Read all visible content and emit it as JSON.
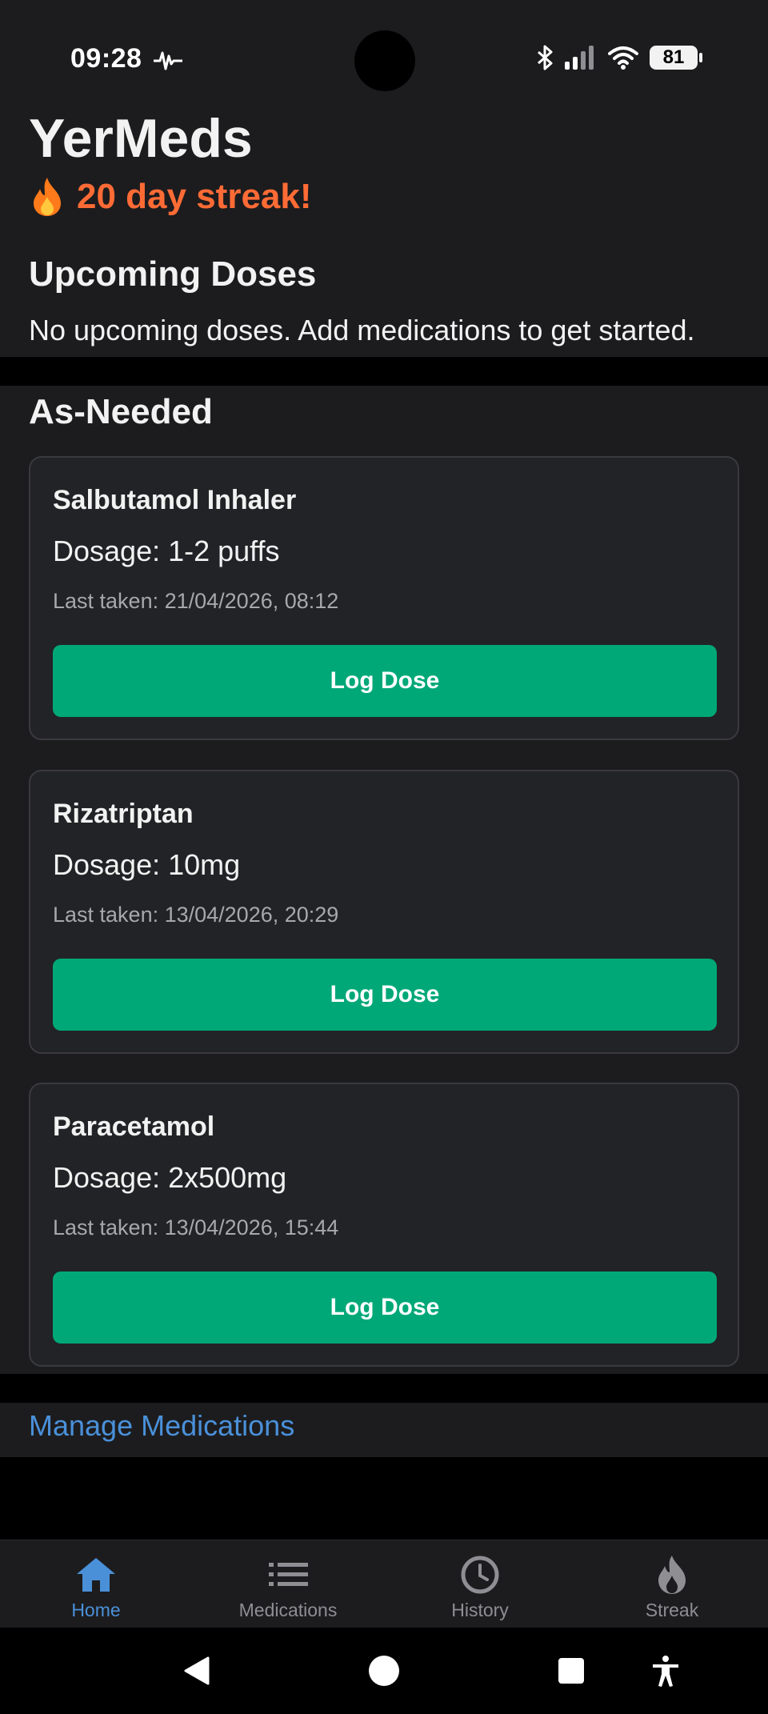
{
  "status_bar": {
    "time": "09:28",
    "battery": "81",
    "icons": [
      "activity-icon",
      "bluetooth-icon",
      "signal-icon",
      "wifi-icon",
      "battery-icon"
    ]
  },
  "header": {
    "app_title": "YerMeds",
    "streak_text": "20 day streak!",
    "streak_color": "#ff6b35"
  },
  "upcoming": {
    "title": "Upcoming Doses",
    "empty_message": "No upcoming doses. Add medications to get started."
  },
  "as_needed": {
    "title": "As-Needed",
    "medications": [
      {
        "name": "Salbutamol Inhaler",
        "dosage": "Dosage: 1-2 puffs",
        "last_taken": "Last taken: 21/04/2026, 08:12",
        "button": "Log Dose"
      },
      {
        "name": "Rizatriptan",
        "dosage": "Dosage: 10mg",
        "last_taken": "Last taken: 13/04/2026, 20:29",
        "button": "Log Dose"
      },
      {
        "name": "Paracetamol",
        "dosage": "Dosage: 2x500mg",
        "last_taken": "Last taken: 13/04/2026, 15:44",
        "button": "Log Dose"
      }
    ]
  },
  "manage_link": "Manage Medications",
  "bottom_nav": {
    "active": "Home",
    "items": [
      {
        "label": "Home",
        "icon": "home-icon"
      },
      {
        "label": "Medications",
        "icon": "list-icon"
      },
      {
        "label": "History",
        "icon": "clock-icon"
      },
      {
        "label": "Streak",
        "icon": "flame-icon"
      }
    ]
  },
  "system_nav": [
    "back-icon",
    "home-circle-icon",
    "recents-icon",
    "accessibility-icon"
  ],
  "colors": {
    "accent": "#4a90d9",
    "button_green": "#00a878",
    "background": "#1c1c1e",
    "card": "#222326"
  }
}
